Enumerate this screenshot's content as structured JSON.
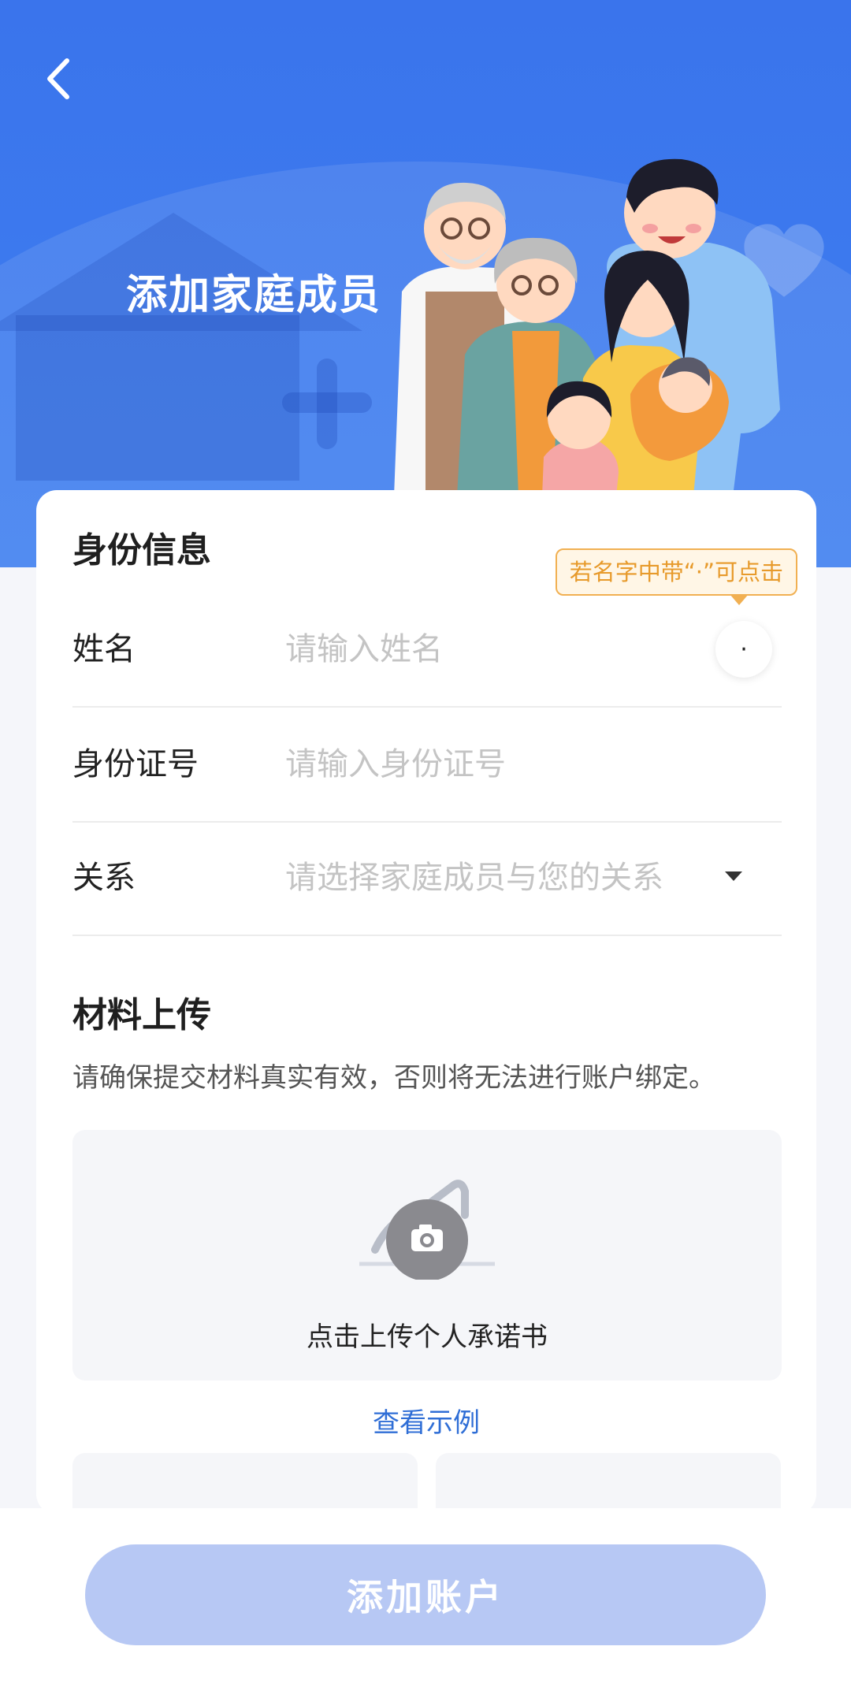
{
  "header": {
    "title": "添加家庭成员"
  },
  "identity_section": {
    "title": "身份信息",
    "tooltip": "若名字中带“·”可点击",
    "dot_symbol": "·",
    "name": {
      "label": "姓名",
      "value": "",
      "placeholder": "请输入姓名"
    },
    "id_number": {
      "label": "身份证号",
      "value": "",
      "placeholder": "请输入身份证号"
    },
    "relation": {
      "label": "关系",
      "value": "",
      "placeholder": "请选择家庭成员与您的关系"
    }
  },
  "materials_section": {
    "title": "材料上传",
    "note": "请确保提交材料真实有效，否则将无法进行账户绑定。",
    "upload_label": "点击上传个人承诺书",
    "example_link": "查看示例"
  },
  "footer": {
    "submit_label": "添加账户"
  },
  "colors": {
    "header_blue": "#3a74ec",
    "link_blue": "#2f6ed6",
    "button_disabled": "#b7c8f4",
    "tooltip_orange": "#e79a2b"
  },
  "icons": {
    "back": "chevron-left-icon",
    "camera": "camera-icon",
    "dropdown": "caret-down-icon"
  }
}
